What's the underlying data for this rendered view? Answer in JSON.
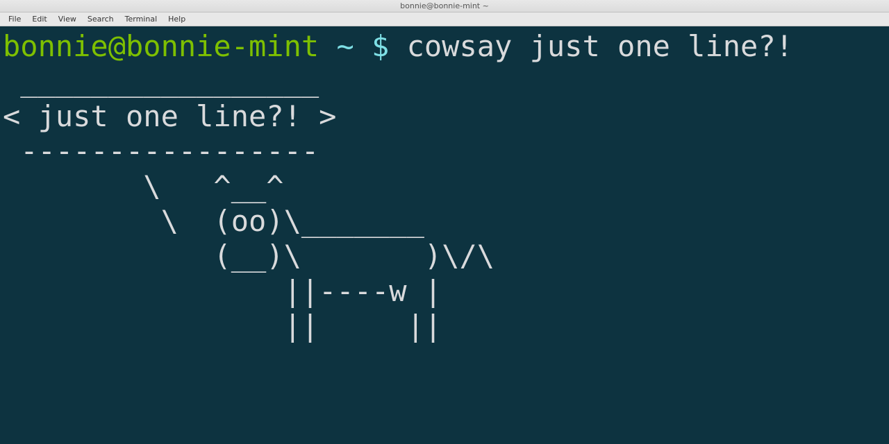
{
  "window": {
    "title": "bonnie@bonnie-mint ~"
  },
  "menubar": {
    "items": [
      "File",
      "Edit",
      "View",
      "Search",
      "Terminal",
      "Help"
    ]
  },
  "prompt": {
    "user_host": "bonnie@bonnie-mint",
    "path": " ~ ",
    "symbol": "$ "
  },
  "command": "cowsay just one line?!",
  "output_lines": [
    " _________________ ",
    "< just one line?! >",
    " ----------------- ",
    "        \\   ^__^",
    "         \\  (oo)\\_______",
    "            (__)\\       )\\/\\",
    "                ||----w |",
    "                ||     ||"
  ]
}
